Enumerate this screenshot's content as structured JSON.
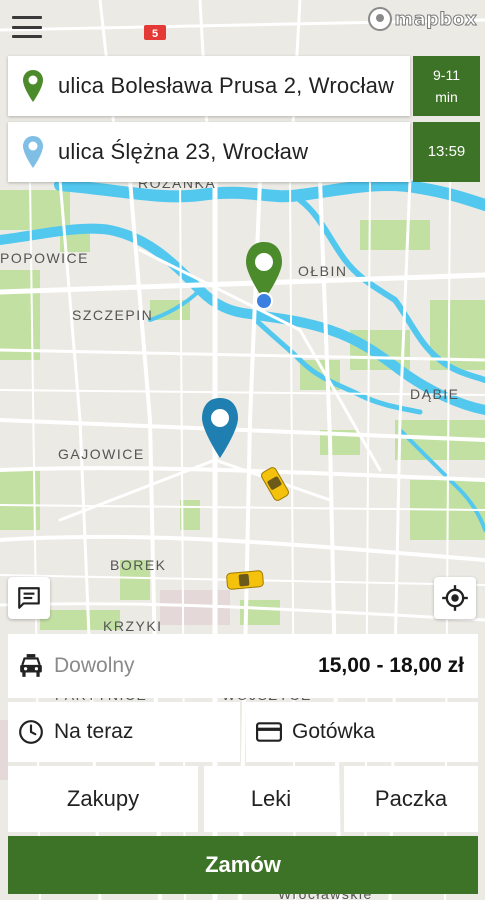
{
  "map": {
    "road_sign": "5",
    "districts": [
      "RÓŻANKA",
      "POPOWICE",
      "OŁBIN",
      "SZCZEPIN",
      "DĄBIE",
      "GAJOWICE",
      "BOREK",
      "KRZYKI",
      "PARTYNICE",
      "WOJSZYCE",
      "Wrocławskie"
    ],
    "colors": {
      "water": "#52c8ef",
      "park": "#c3e0a3",
      "road": "#ffffff",
      "land": "#eceae4"
    }
  },
  "header": {
    "logo_text": "mapbox"
  },
  "pickup": {
    "address": "ulica Bolesława Prusa 2, Wrocław",
    "eta_top": "9-11",
    "eta_bottom": "min"
  },
  "destination": {
    "address": "ulica Ślężna 23, Wrocław",
    "time": "13:59"
  },
  "options": {
    "vehicle_label": "Dowolny",
    "price": "15,00 - 18,00 zł",
    "time_label": "Na teraz",
    "payment_label": "Gotówka",
    "extras": [
      "Zakupy",
      "Leki",
      "Paczka"
    ]
  },
  "order_button": "Zamów",
  "colors": {
    "brand_green": "#3d7326",
    "pickup_pin": "#4c8b2b",
    "destination_pin": "#1e7fb0",
    "taxi": "#f4c10d"
  }
}
